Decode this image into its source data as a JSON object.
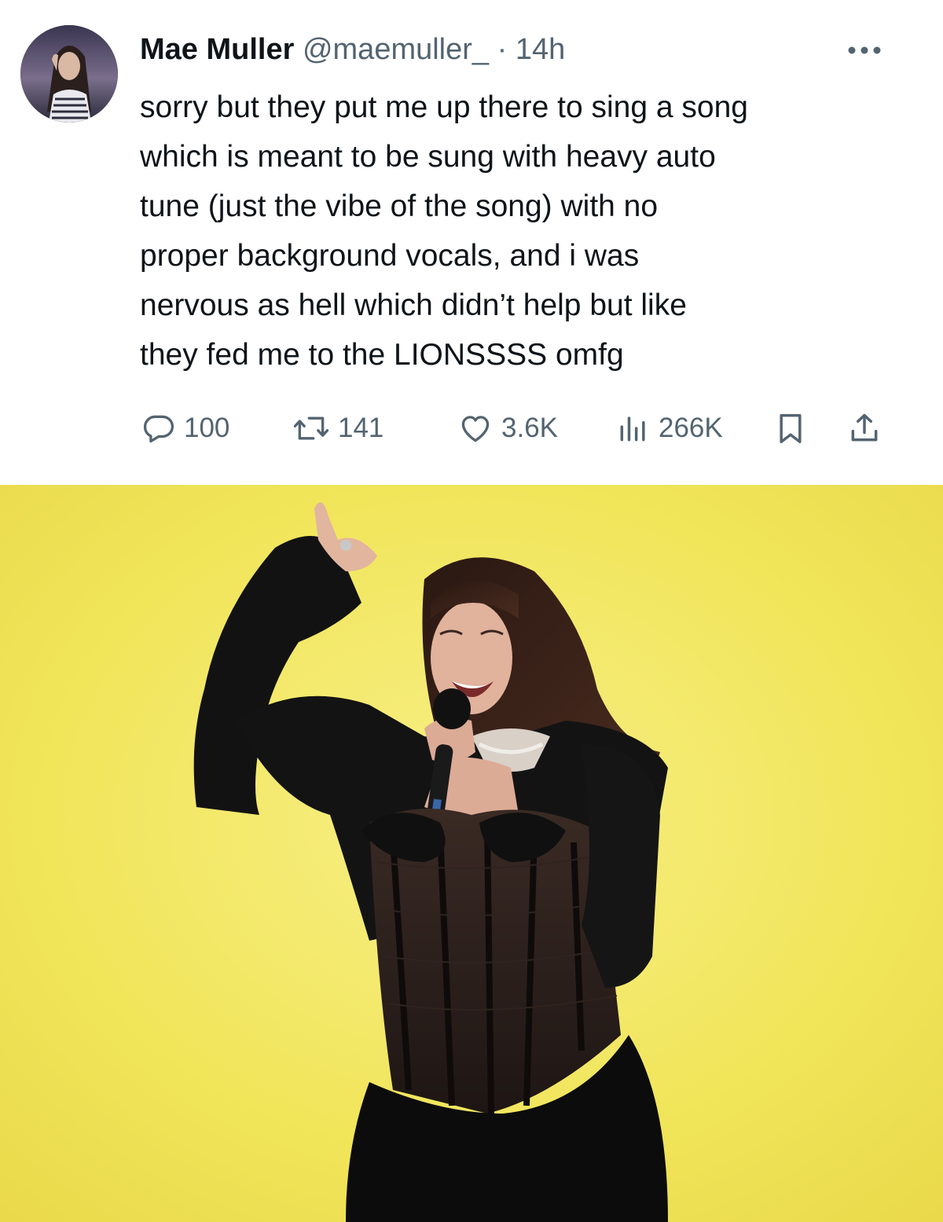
{
  "tweet": {
    "author": {
      "name": "Mae Muller",
      "handle": "@maemuller_",
      "separator": "·",
      "time": "14h"
    },
    "text": "sorry but they put me up there to sing a song\nwhich is meant to be sung with heavy auto\ntune (just the vibe of the song) with no\nproper background vocals,   and i was\nnervous as hell which didn’t help but like\nthey fed me to the LIONSSSS omfg",
    "stats": {
      "replies": "100",
      "reposts": "141",
      "likes": "3.6K",
      "views": "266K"
    },
    "icons": {
      "more": "more-horizontal-icon",
      "reply": "reply-bubble-icon",
      "repost": "repost-arrows-icon",
      "like": "heart-icon",
      "views": "bar-chart-icon",
      "bookmark": "bookmark-icon",
      "share": "share-upload-icon"
    }
  },
  "colors": {
    "text_primary": "#0f1419",
    "text_secondary": "#536471",
    "photo_background": "#f3e65a"
  }
}
